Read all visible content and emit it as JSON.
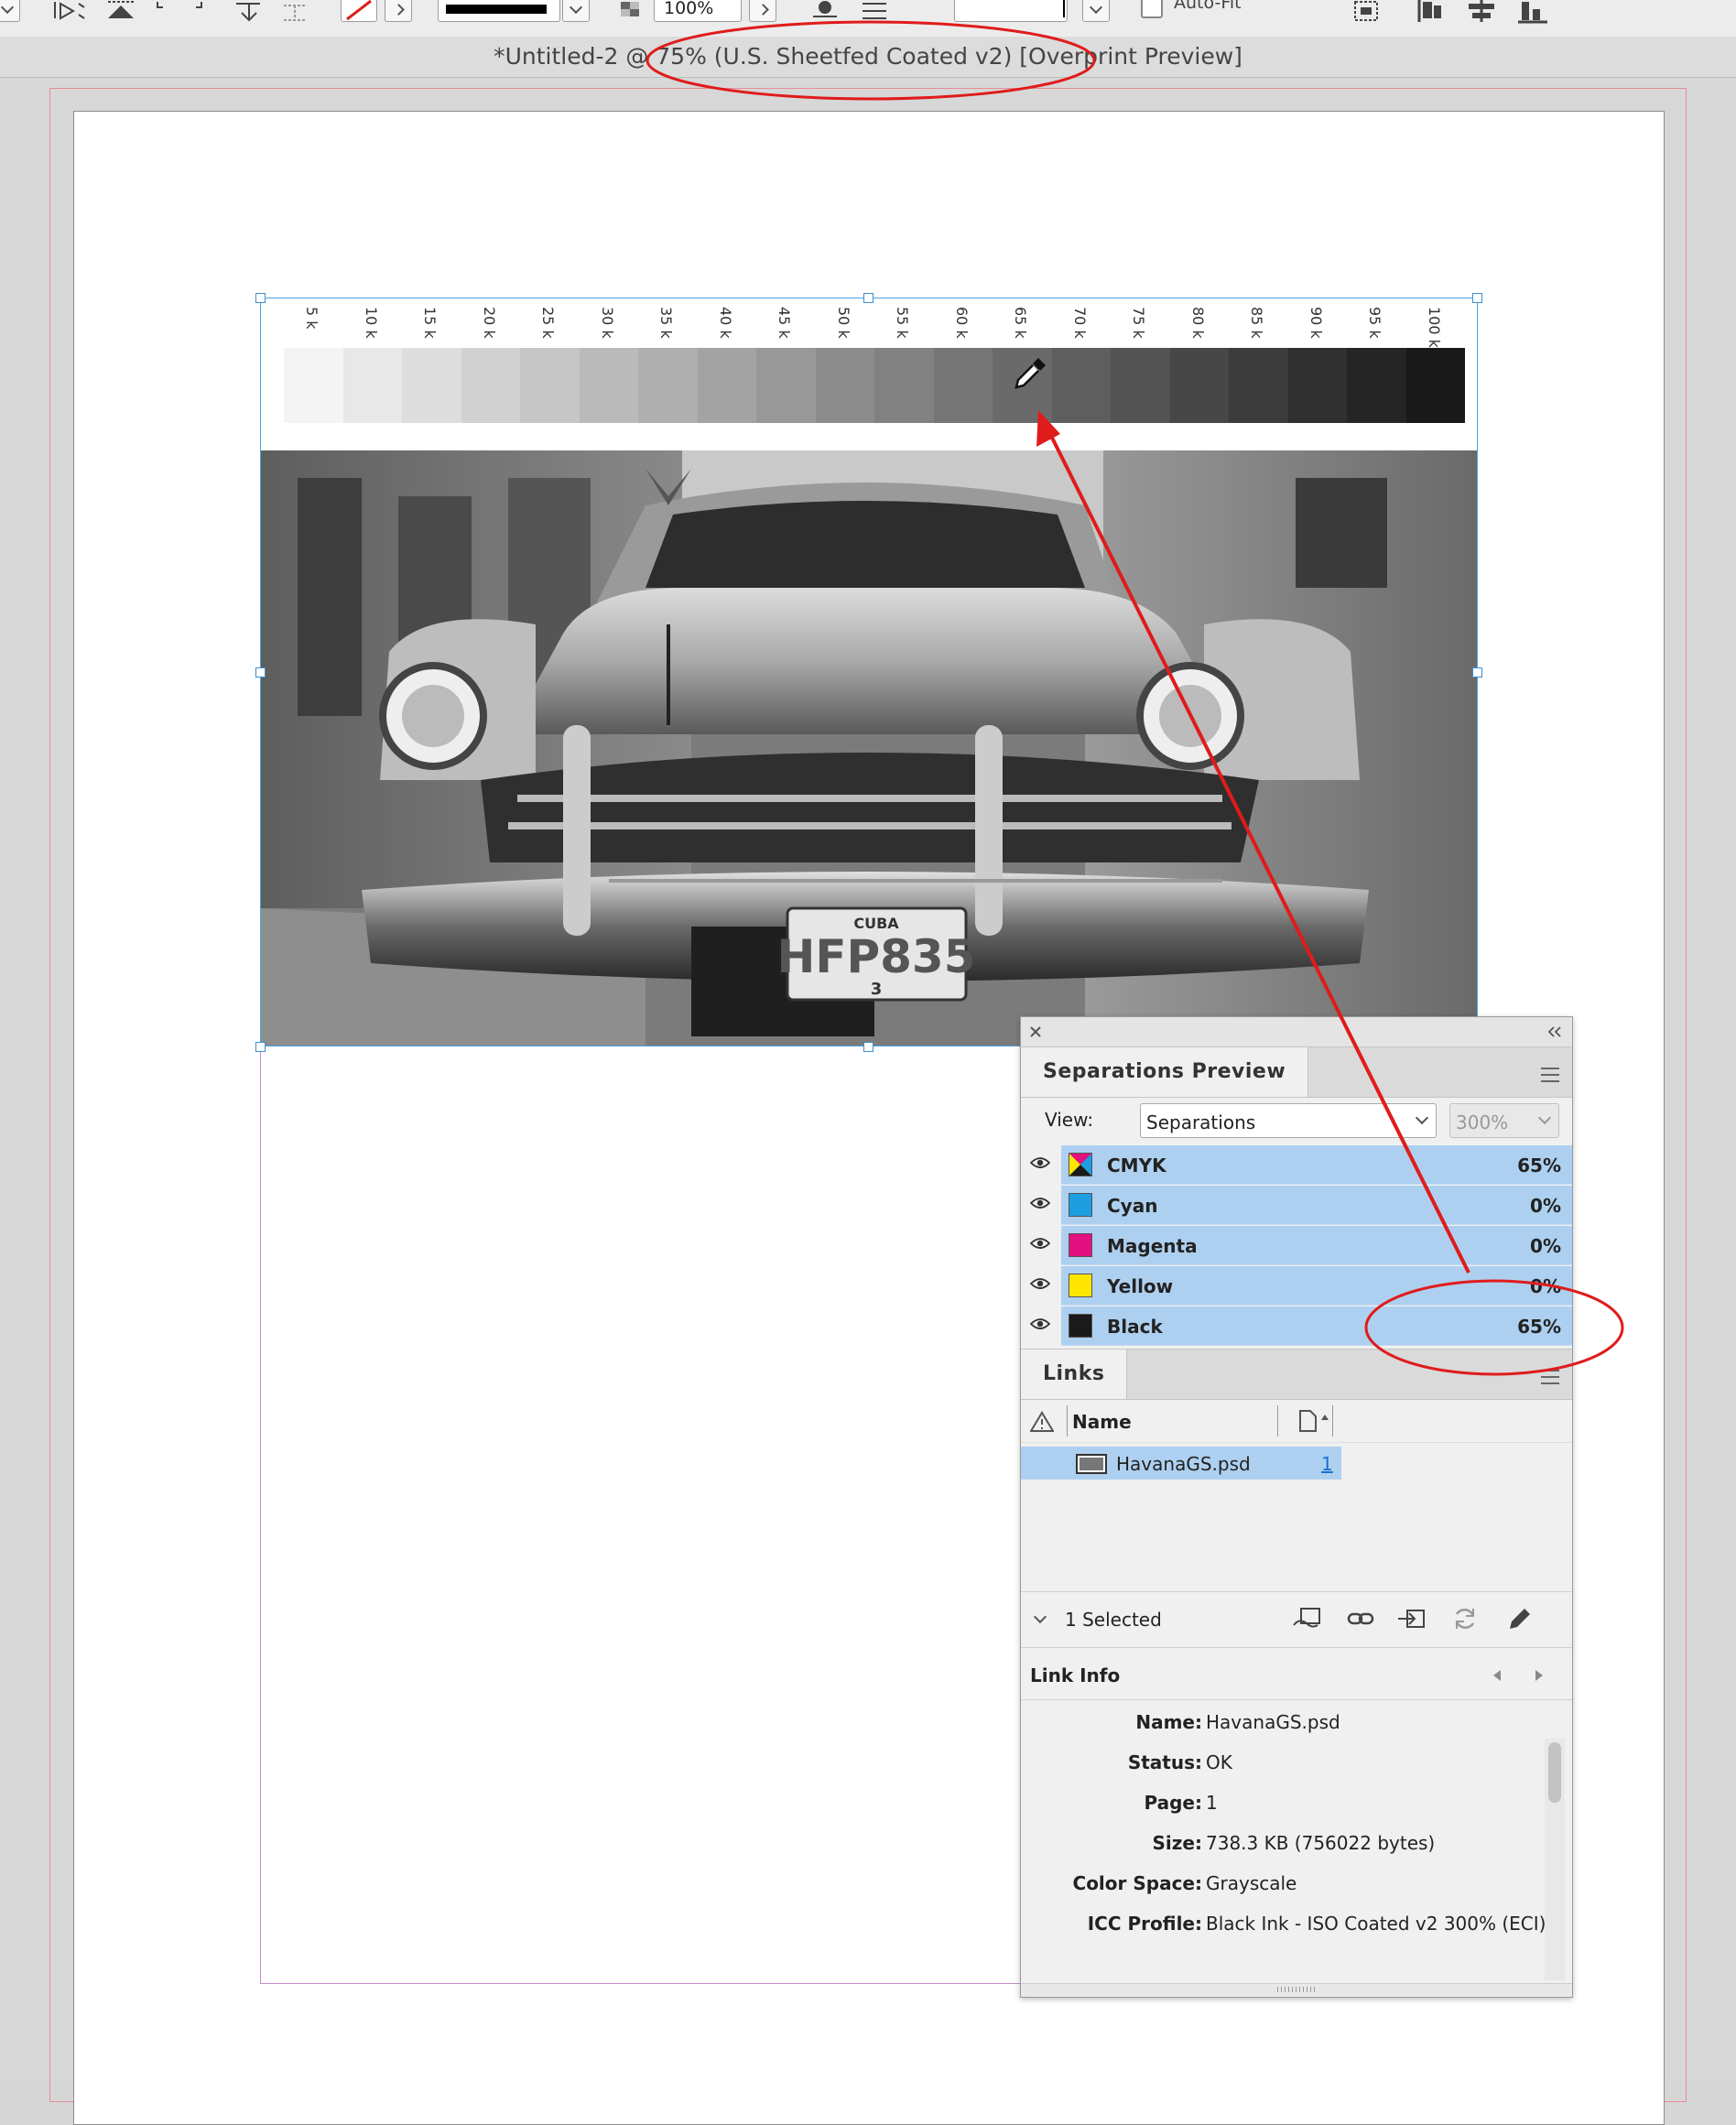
{
  "toolbar": {
    "zoom_value": "100%",
    "auto_fit_label": "Auto-Fit"
  },
  "document_title": "*Untitled-2 @ 75% (U.S. Sheetfed Coated v2) [Overprint Preview]",
  "ramp": {
    "labels": [
      "5 k",
      "10 k",
      "15 k",
      "20 k",
      "25 k",
      "30 k",
      "35 k",
      "40 k",
      "45 k",
      "50 k",
      "55 k",
      "60 k",
      "65 k",
      "70 k",
      "75 k",
      "80 k",
      "85 k",
      "90 k",
      "95 k",
      "100 k"
    ],
    "black_percent": [
      5,
      10,
      15,
      20,
      25,
      30,
      35,
      40,
      45,
      50,
      55,
      60,
      65,
      70,
      75,
      80,
      85,
      90,
      95,
      100
    ]
  },
  "photo": {
    "plate_top": "CUBA",
    "plate_number": "HFP835",
    "plate_bottom": "3"
  },
  "separations_panel": {
    "tab_label": "Separations Preview",
    "view_label": "View:",
    "view_value": "Separations",
    "ink_limit": "300%",
    "rows": [
      {
        "name": "CMYK",
        "value": "65%",
        "color": "cmyk"
      },
      {
        "name": "Cyan",
        "value": "0%",
        "color": "#1d9ee0"
      },
      {
        "name": "Magenta",
        "value": "0%",
        "color": "#e2117f"
      },
      {
        "name": "Yellow",
        "value": "0%",
        "color": "#ffe600"
      },
      {
        "name": "Black",
        "value": "65%",
        "color": "#1a1a1a"
      }
    ]
  },
  "links_panel": {
    "tab_label": "Links",
    "col_name": "Name",
    "files": [
      {
        "name": "HavanaGS.psd",
        "page": "1"
      }
    ],
    "selected_count": "1 Selected"
  },
  "link_info": {
    "title": "Link Info",
    "rows": [
      {
        "key": "Name:",
        "value": "HavanaGS.psd"
      },
      {
        "key": "Status:",
        "value": "OK"
      },
      {
        "key": "Page:",
        "value": "1"
      },
      {
        "key": "Size:",
        "value": "738.3 KB (756022 bytes)"
      },
      {
        "key": "Color Space:",
        "value": "Grayscale"
      },
      {
        "key": "ICC Profile:",
        "value": "Black Ink - ISO Coated v2 300% (ECI)"
      }
    ]
  },
  "colors": {
    "selection_blue": "#aed0f0",
    "annotation_red": "#e01b1b",
    "frame_blue": "#4aa3dc"
  }
}
